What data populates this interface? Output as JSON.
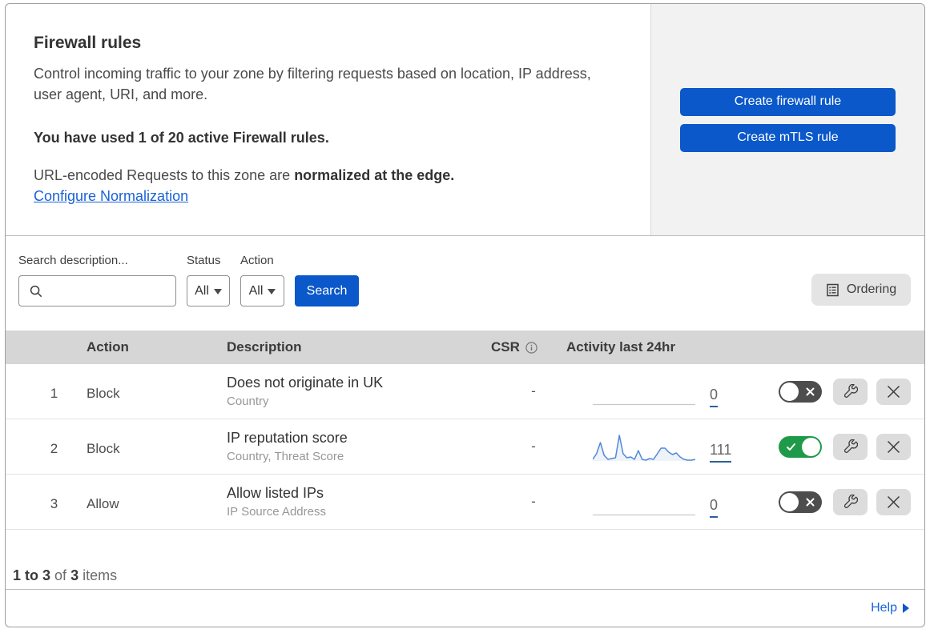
{
  "page": {
    "title": "Firewall rules",
    "description": "Control incoming traffic to your zone by filtering requests based on location, IP address, user agent, URI, and more.",
    "usage_notice": "You have used 1 of 20 active Firewall rules.",
    "normalization_prefix": "URL-encoded Requests to this zone are ",
    "normalization_bold": "normalized at the edge.",
    "normalization_link": "Configure Normalization"
  },
  "actions_panel": {
    "create_firewall_label": "Create firewall rule",
    "create_mtls_label": "Create mTLS rule"
  },
  "filters": {
    "search_label": "Search description...",
    "status_label": "Status",
    "status_value": "All",
    "action_label": "Action",
    "action_value": "All",
    "search_button": "Search",
    "ordering_button": "Ordering"
  },
  "table": {
    "columns": {
      "action": "Action",
      "description": "Description",
      "csr": "CSR",
      "activity": "Activity last 24hr"
    },
    "rows": [
      {
        "index": "1",
        "action": "Block",
        "description": "Does not originate in UK",
        "criteria": "Country",
        "csr": "-",
        "activity_count": "0",
        "enabled": false
      },
      {
        "index": "2",
        "action": "Block",
        "description": "IP reputation score",
        "criteria": "Country, Threat Score",
        "csr": "-",
        "activity_count": "111",
        "enabled": true
      },
      {
        "index": "3",
        "action": "Allow",
        "description": "Allow listed IPs",
        "criteria": "IP Source Address",
        "csr": "-",
        "activity_count": "0",
        "enabled": false
      }
    ]
  },
  "chart_data": {
    "type": "line",
    "title": "Activity last 24hr sparkline (rule 2)",
    "x_range_hours": 24,
    "total": 111,
    "values": [
      34,
      27,
      13,
      29,
      34,
      33,
      32,
      4,
      27,
      32,
      31,
      34,
      23,
      34,
      35,
      33,
      34,
      27,
      20,
      20,
      25,
      28,
      26,
      31,
      34,
      35,
      35,
      34
    ],
    "y_inverted_px": true,
    "line_color": "#5187d7",
    "fill_color": "#eef2f9"
  },
  "footer": {
    "items_range": "1 to 3",
    "items_of": "of",
    "items_total": "3",
    "items_word": "items",
    "help_label": "Help"
  },
  "colors": {
    "accent_blue": "#0a58ca",
    "link_blue": "#1a62d5",
    "toggle_on_green": "#219447",
    "toggle_off_gray": "#4d4d4d",
    "table_header_bg": "#d6d6d6",
    "panel_bg": "#f2f2f2"
  }
}
